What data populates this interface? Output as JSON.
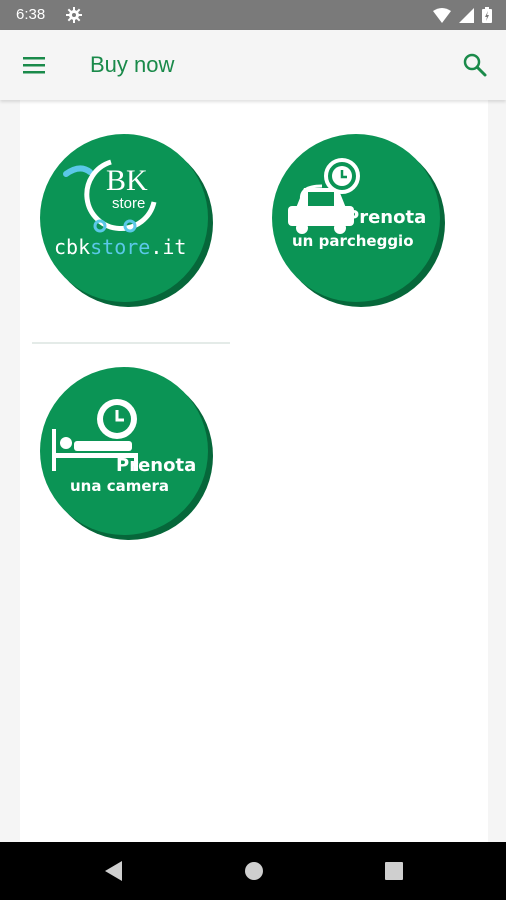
{
  "status_bar": {
    "time": "6:38",
    "icons": [
      "gear-icon",
      "wifi-icon",
      "signal-icon",
      "battery-icon"
    ]
  },
  "app_bar": {
    "title": "Buy now",
    "icons": [
      "menu-icon",
      "search-icon"
    ]
  },
  "colors": {
    "accent": "#1a8a4a",
    "tile_green": "#0b9455",
    "tile_shadow": "#06673a",
    "text_white": "#ffffff",
    "teal": "#5bc8e8"
  },
  "tiles": [
    {
      "logo_main": "BK",
      "logo_sub": "store",
      "text_dark": "cbk",
      "text_accent": "store",
      "text_suffix": ".it",
      "icon": "cart-icon"
    },
    {
      "line1": "Prenota",
      "line2": "un parcheggio",
      "icon": "car-clock-icon"
    },
    {
      "line1": "Prenota",
      "line2": "una camera",
      "icon": "bed-clock-icon"
    }
  ],
  "nav_bar": {
    "icons": [
      "back-icon",
      "home-icon",
      "recents-icon"
    ]
  }
}
